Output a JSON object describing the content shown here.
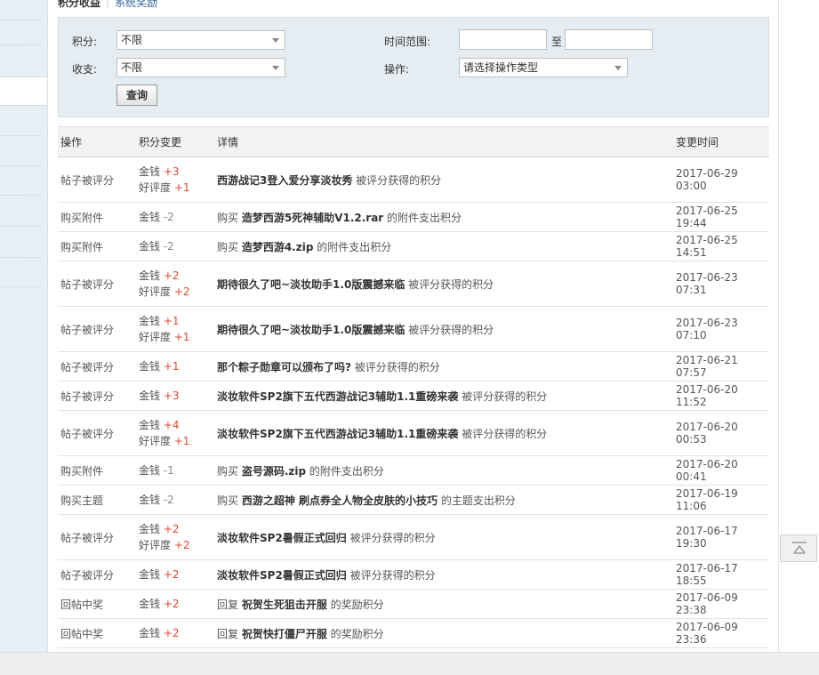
{
  "tabs": {
    "active": "积分收益",
    "separator": "|",
    "link": "系统奖励"
  },
  "filter": {
    "points_label": "积分:",
    "points_value": "不限",
    "flow_label": "收支:",
    "flow_value": "不限",
    "range_label": "时间范围:",
    "range_to": "至",
    "range_start": "",
    "range_end": "",
    "op_label": "操作:",
    "op_value": "请选择操作类型",
    "query_button": "查询"
  },
  "table": {
    "headers": {
      "op": "操作",
      "change": "积分变更",
      "detail": "详情",
      "time": "变更时间"
    },
    "rows": [
      {
        "op": "帖子被评分",
        "c1n": "金钱",
        "c1v": "+3",
        "c2n": "好评度",
        "c2v": "+1",
        "pre": "",
        "title": "西游战记3登入爱分享淡妆秀",
        "post": " 被评分获得的积分",
        "time": "2017-06-29 03:00"
      },
      {
        "op": "购买附件",
        "c1n": "金钱",
        "c1v": "-2",
        "pre": "购买 ",
        "title": "造梦西游5死神辅助V1.2.rar",
        "post": " 的附件支出积分",
        "time": "2017-06-25 19:44"
      },
      {
        "op": "购买附件",
        "c1n": "金钱",
        "c1v": "-2",
        "pre": "购买 ",
        "title": "造梦西游4.zip",
        "post": " 的附件支出积分",
        "time": "2017-06-25 14:51"
      },
      {
        "op": "帖子被评分",
        "c1n": "金钱",
        "c1v": "+2",
        "c2n": "好评度",
        "c2v": "+2",
        "pre": "",
        "title": "期待很久了吧~淡妆助手1.0版震撼来临",
        "post": " 被评分获得的积分",
        "time": "2017-06-23 07:31"
      },
      {
        "op": "帖子被评分",
        "c1n": "金钱",
        "c1v": "+1",
        "c2n": "好评度",
        "c2v": "+1",
        "pre": "",
        "title": "期待很久了吧~淡妆助手1.0版震撼来临",
        "post": " 被评分获得的积分",
        "time": "2017-06-23 07:10"
      },
      {
        "op": "帖子被评分",
        "c1n": "金钱",
        "c1v": "+1",
        "pre": "",
        "title": "那个粽子勋章可以颁布了吗?",
        "post": " 被评分获得的积分",
        "time": "2017-06-21 07:57"
      },
      {
        "op": "帖子被评分",
        "c1n": "金钱",
        "c1v": "+3",
        "pre": "",
        "title": "淡妆软件SP2旗下五代西游战记3辅助1.1重磅来袭",
        "post": " 被评分获得的积分",
        "time": "2017-06-20 11:52"
      },
      {
        "op": "帖子被评分",
        "c1n": "金钱",
        "c1v": "+4",
        "c2n": "好评度",
        "c2v": "+1",
        "pre": "",
        "title": "淡妆软件SP2旗下五代西游战记3辅助1.1重磅来袭",
        "post": " 被评分获得的积分",
        "time": "2017-06-20 00:53"
      },
      {
        "op": "购买附件",
        "c1n": "金钱",
        "c1v": "-1",
        "pre": "购买 ",
        "title": "盗号源码.zip",
        "post": " 的附件支出积分",
        "time": "2017-06-20 00:41"
      },
      {
        "op": "购买主题",
        "c1n": "金钱",
        "c1v": "-2",
        "pre": "购买 ",
        "title": "西游之超神 刷点券全人物全皮肤的小技巧",
        "post": " 的主题支出积分",
        "time": "2017-06-19 11:06"
      },
      {
        "op": "帖子被评分",
        "c1n": "金钱",
        "c1v": "+2",
        "c2n": "好评度",
        "c2v": "+2",
        "pre": "",
        "title": "淡妆软件SP2暑假正式回归",
        "post": " 被评分获得的积分",
        "time": "2017-06-17 19:30"
      },
      {
        "op": "帖子被评分",
        "c1n": "金钱",
        "c1v": "+2",
        "pre": "",
        "title": "淡妆软件SP2暑假正式回归",
        "post": " 被评分获得的积分",
        "time": "2017-06-17 18:55"
      },
      {
        "op": "回帖中奖",
        "c1n": "金钱",
        "c1v": "+2",
        "pre": "回复 ",
        "title": "祝贺生死狙击开服",
        "post": " 的奖励积分",
        "time": "2017-06-09 23:38"
      },
      {
        "op": "回帖中奖",
        "c1n": "金钱",
        "c1v": "+2",
        "pre": "回复 ",
        "title": "祝贺快打僵尸开服",
        "post": " 的奖励积分",
        "time": "2017-06-09 23:36"
      }
    ]
  },
  "colors": {
    "positive": "#e4462e",
    "negative": "#888888",
    "panel": "#e5edf2",
    "link": "#336699"
  },
  "icons": {
    "back_to_top": "arrow-up-icon"
  }
}
